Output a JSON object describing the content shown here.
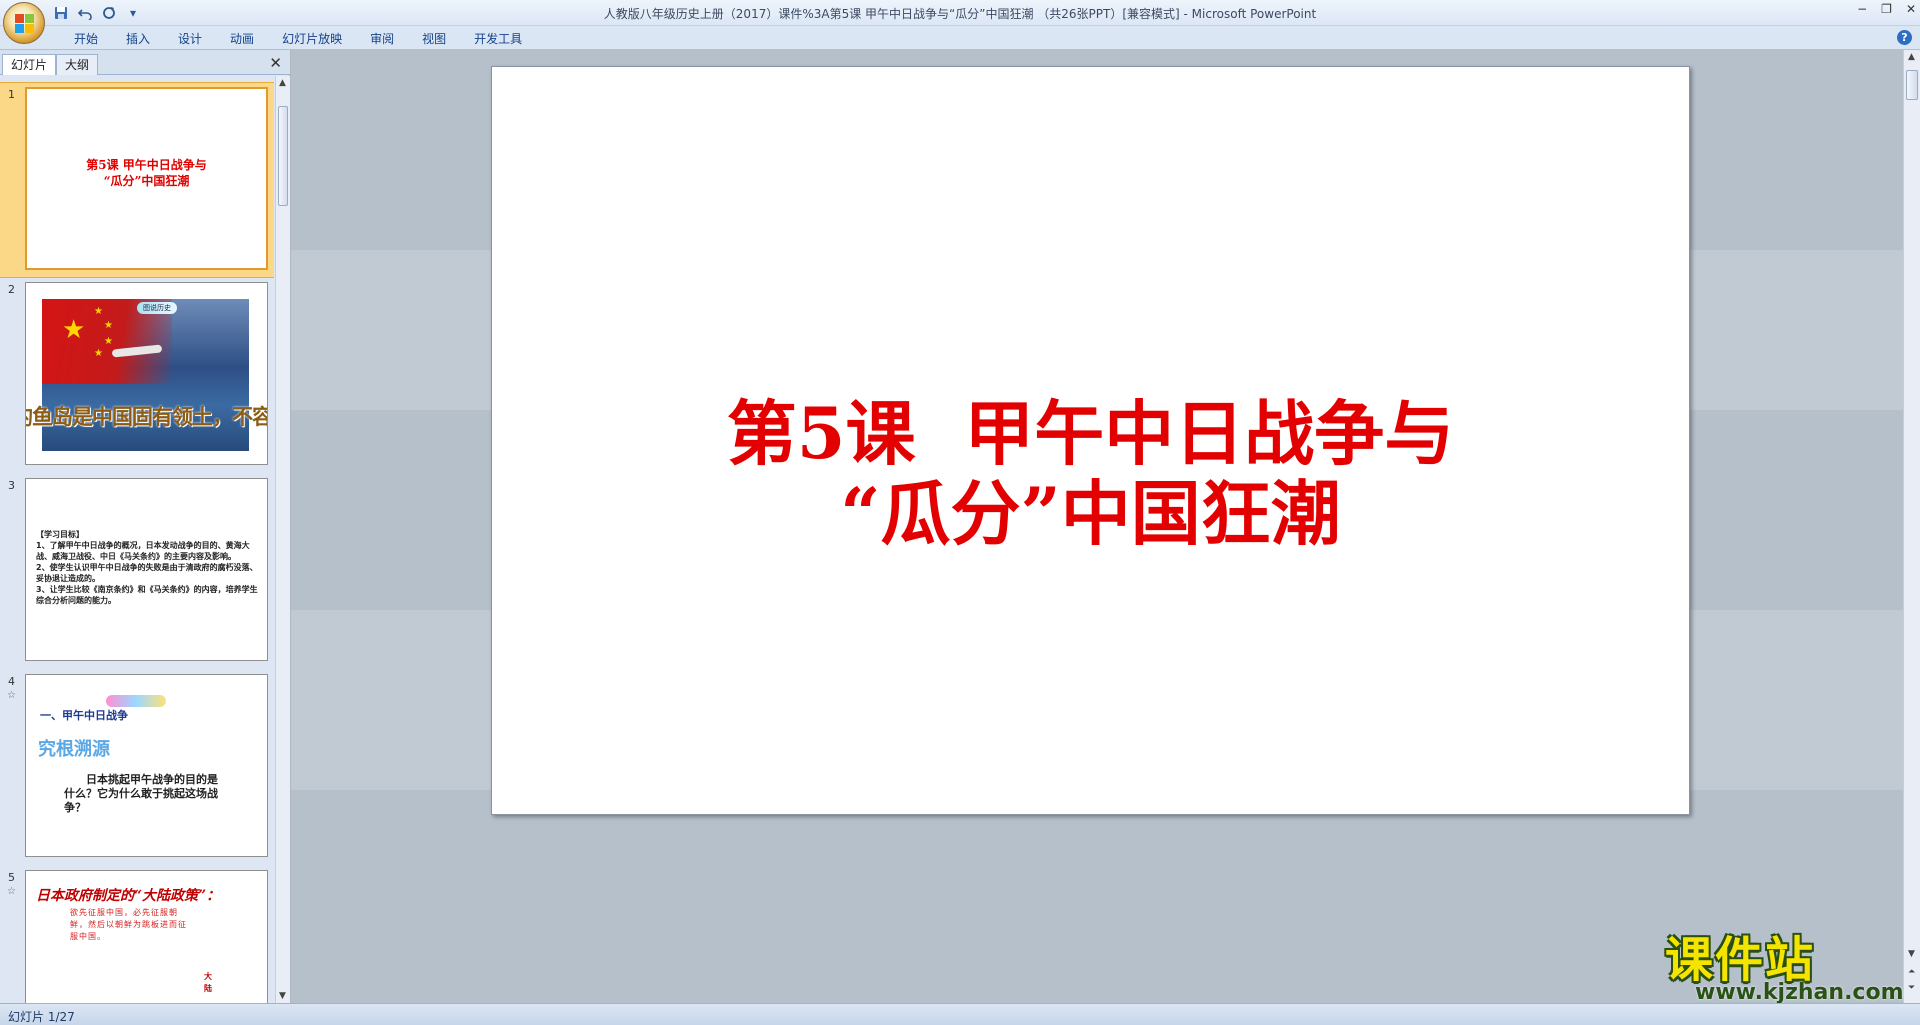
{
  "window": {
    "title": "人教版八年级历史上册（2017）课件%3A第5课 甲午中日战争与“瓜分”中国狂潮 （共26张PPT）[兼容模式] - Microsoft PowerPoint"
  },
  "quick_access": {
    "save_icon": "save-icon",
    "undo_icon": "undo-icon",
    "redo_icon": "repeat-icon",
    "customize_glyph": "▾"
  },
  "window_controls": {
    "minimize": "−",
    "restore": "❐",
    "close": "✕"
  },
  "ribbon": {
    "tabs": [
      "开始",
      "插入",
      "设计",
      "动画",
      "幻灯片放映",
      "审阅",
      "视图",
      "开发工具"
    ],
    "help_glyph": "?"
  },
  "left_pane": {
    "tabs": [
      "幻灯片",
      "大纲"
    ],
    "close_glyph": "✕",
    "anim_glyph": "☆",
    "slides": [
      {
        "number": "1",
        "title_line1": "第5课 甲午中日战争与",
        "title_line2": "“瓜分”中国狂潮"
      },
      {
        "number": "2",
        "badge": "图说历史",
        "caption": "钓鱼岛是中国固有领土，不容侵犯！"
      },
      {
        "number": "3",
        "lines": [
          "【学习目标】",
          "1、了解甲午中日战争的概况，日本发动战争的目的、黄海大战、威海卫战役、中日《马关条约》的主要内容及影响。",
          "2、使学生认识甲午中日战争的失败是由于清政府的腐朽没落、妥协退让造成的。",
          "3、让学生比较《南京条约》和《马关条约》的内容，培养学生综合分析问题的能力。"
        ]
      },
      {
        "number": "4",
        "subtitle": "一、甲午中日战争",
        "heading": "究根溯源",
        "question": "日本挑起甲午战争的目的是什么？它为什么敢于挑起这场战争？"
      },
      {
        "number": "5",
        "heading": "日本政府制定的“大陆政策”：",
        "body": "欲先征服中国，必先征服朝鲜，然后以朝鲜为跳板进而征服中国。",
        "side": "大陆"
      }
    ]
  },
  "slide": {
    "title_line1": "第5课  甲午中日战争与",
    "title_line2": "“瓜分”中国狂潮"
  },
  "watermark": {
    "brand": "课件站",
    "url": "www.kjzhan.com"
  },
  "status": {
    "text": "幻灯片 1/27"
  },
  "colors": {
    "title_red": "#e30000",
    "accent_orange": "#fbd888"
  }
}
